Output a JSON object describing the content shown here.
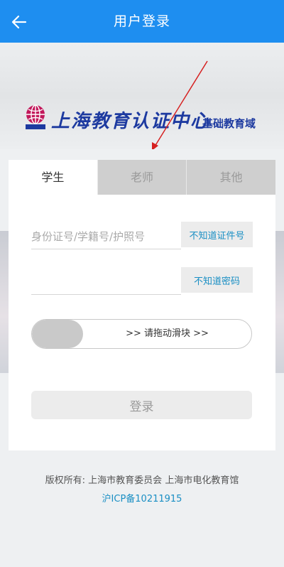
{
  "header": {
    "title": "用户登录",
    "back_icon": "arrow-left-icon",
    "background_color": "#1e8ef0"
  },
  "banner": {
    "title": "上海教育认证中心",
    "subtitle": "基础教育域",
    "logo_icon": "globe-logo",
    "annotation_color": "#d62020"
  },
  "tabs": [
    {
      "label": "学生",
      "active": true
    },
    {
      "label": "老师",
      "active": false
    },
    {
      "label": "其他",
      "active": false
    }
  ],
  "form": {
    "id_placeholder": "身份证号/学籍号/护照号",
    "id_value": "",
    "id_help_button": "不知道证件号",
    "password_placeholder": "",
    "password_value": "",
    "password_help_button": "不知道密码",
    "slider_text": ">> 请拖动滑块 >>",
    "login_button": "登录",
    "accent_color": "#1a8fc4"
  },
  "footer": {
    "copyright": "版权所有: 上海市教育委员会 上海市电化教育馆",
    "icp": "沪ICP备10211915"
  }
}
